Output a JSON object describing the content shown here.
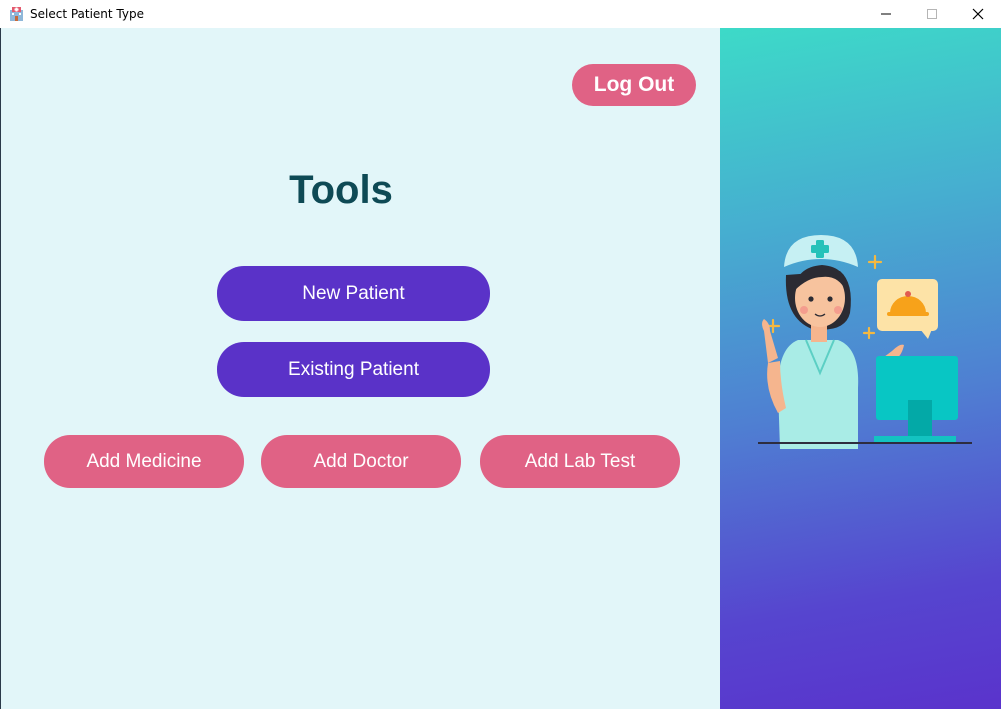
{
  "window": {
    "title": "Select Patient Type",
    "icon": "hospital-icon"
  },
  "header": {
    "logout_label": "Log Out"
  },
  "main": {
    "title": "Tools",
    "primary_buttons": [
      {
        "label": "New Patient"
      },
      {
        "label": "Existing Patient"
      }
    ],
    "secondary_buttons": [
      {
        "label": "Add Medicine"
      },
      {
        "label": "Add Doctor"
      },
      {
        "label": "Add Lab Test"
      }
    ]
  },
  "illustration": {
    "icon": "nurse-illustration"
  },
  "colors": {
    "left_background": "#e2f6f9",
    "primary_button": "#5a32c8",
    "secondary_button": "#e06285",
    "title_text": "#0e4a55",
    "sidebar_gradient_top": "#3ddac8",
    "sidebar_gradient_bottom": "#5a33cc"
  }
}
